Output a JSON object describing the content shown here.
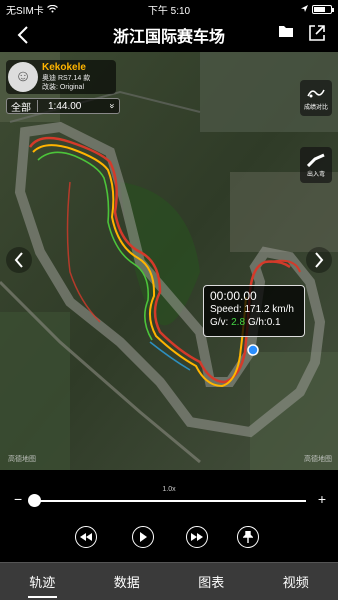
{
  "status": {
    "carrier": "无SIM卡",
    "time": "下午 5:10"
  },
  "nav": {
    "title": "浙江国际赛车场"
  },
  "driver": {
    "name": "Kekokele",
    "car": "奥迪 RS7.14 款",
    "mod": "改装: Original"
  },
  "lap": {
    "label": "全部",
    "time": "1:44.00",
    "dropdown": "»"
  },
  "side": {
    "compare": "成绩对比",
    "inout": "出入弯"
  },
  "hud": {
    "time": "00:00.00",
    "speed_label": "Speed:",
    "speed": "171.2 km/h",
    "gv_label": "G/v:",
    "gv": "2.8",
    "gh_label": "G/h:",
    "gh": "0.1"
  },
  "watermark": {
    "left": "高德地图",
    "right": "高德地图"
  },
  "player": {
    "zoom": "1.0x",
    "minus": "−",
    "plus": "+",
    "progress": 0.0
  },
  "tabs": [
    "轨迹",
    "数据",
    "图表",
    "视频"
  ],
  "colors": {
    "accent": "#ffb400",
    "gv": "#45d645",
    "tabbar": "#3a3a3a"
  }
}
